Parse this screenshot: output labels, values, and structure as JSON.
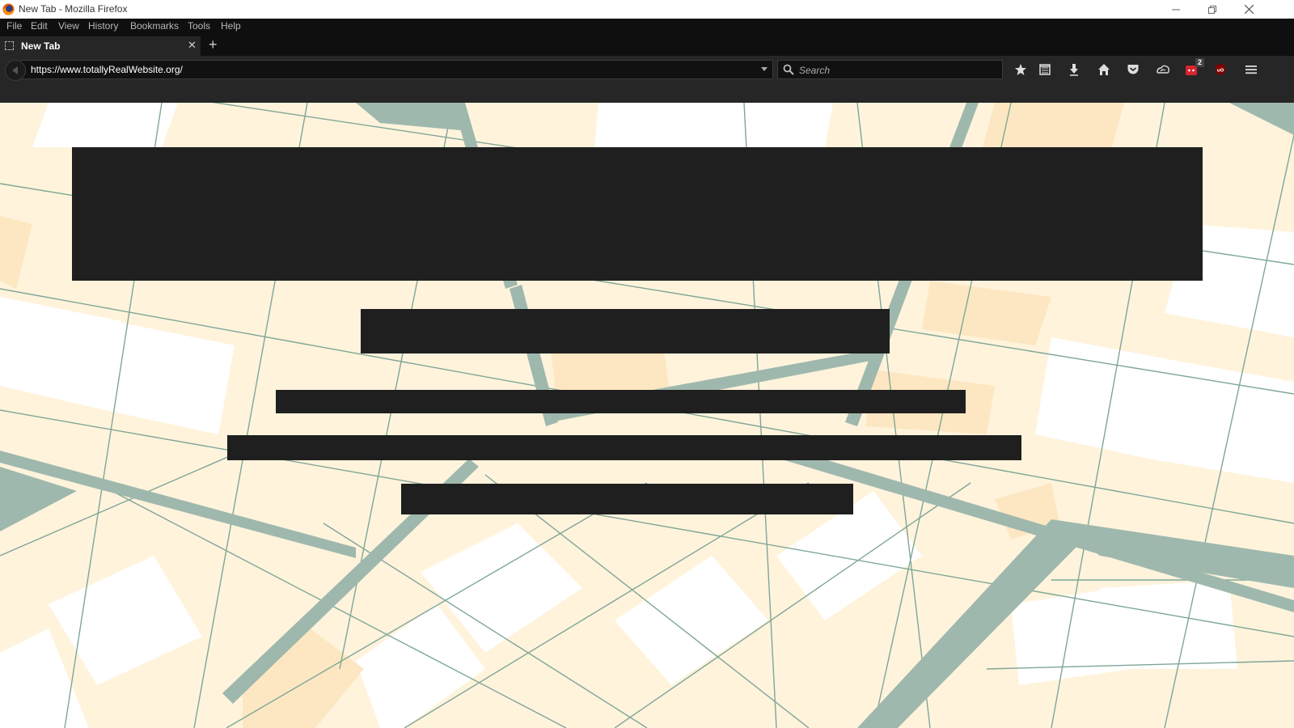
{
  "window": {
    "title": "New Tab - Mozilla Firefox"
  },
  "menu": {
    "items": [
      "File",
      "Edit",
      "View",
      "History",
      "Bookmarks",
      "Tools",
      "Help"
    ]
  },
  "tabs": [
    {
      "label": "New Tab",
      "active": true
    }
  ],
  "navbar": {
    "url": "https://www.totallyRealWebsite.org/",
    "search_placeholder": "Search",
    "toolbar_icons": [
      "star-icon",
      "reading-list-icon",
      "download-icon",
      "home-icon",
      "pocket-icon",
      "sync-icon",
      "extension-icon",
      "ublock-icon",
      "hamburger-menu-icon"
    ],
    "extension_badge": "2"
  },
  "content": {
    "background": "map-pattern",
    "redacted_blocks": [
      "heading",
      "subheading",
      "line-1",
      "line-2",
      "line-3"
    ]
  },
  "colors": {
    "chrome_dark": "#262626",
    "menubar": "#0f0f0f",
    "map_beige": "#fff3dc",
    "map_road": "#9fb8ad",
    "redaction": "#1f1f1f"
  }
}
